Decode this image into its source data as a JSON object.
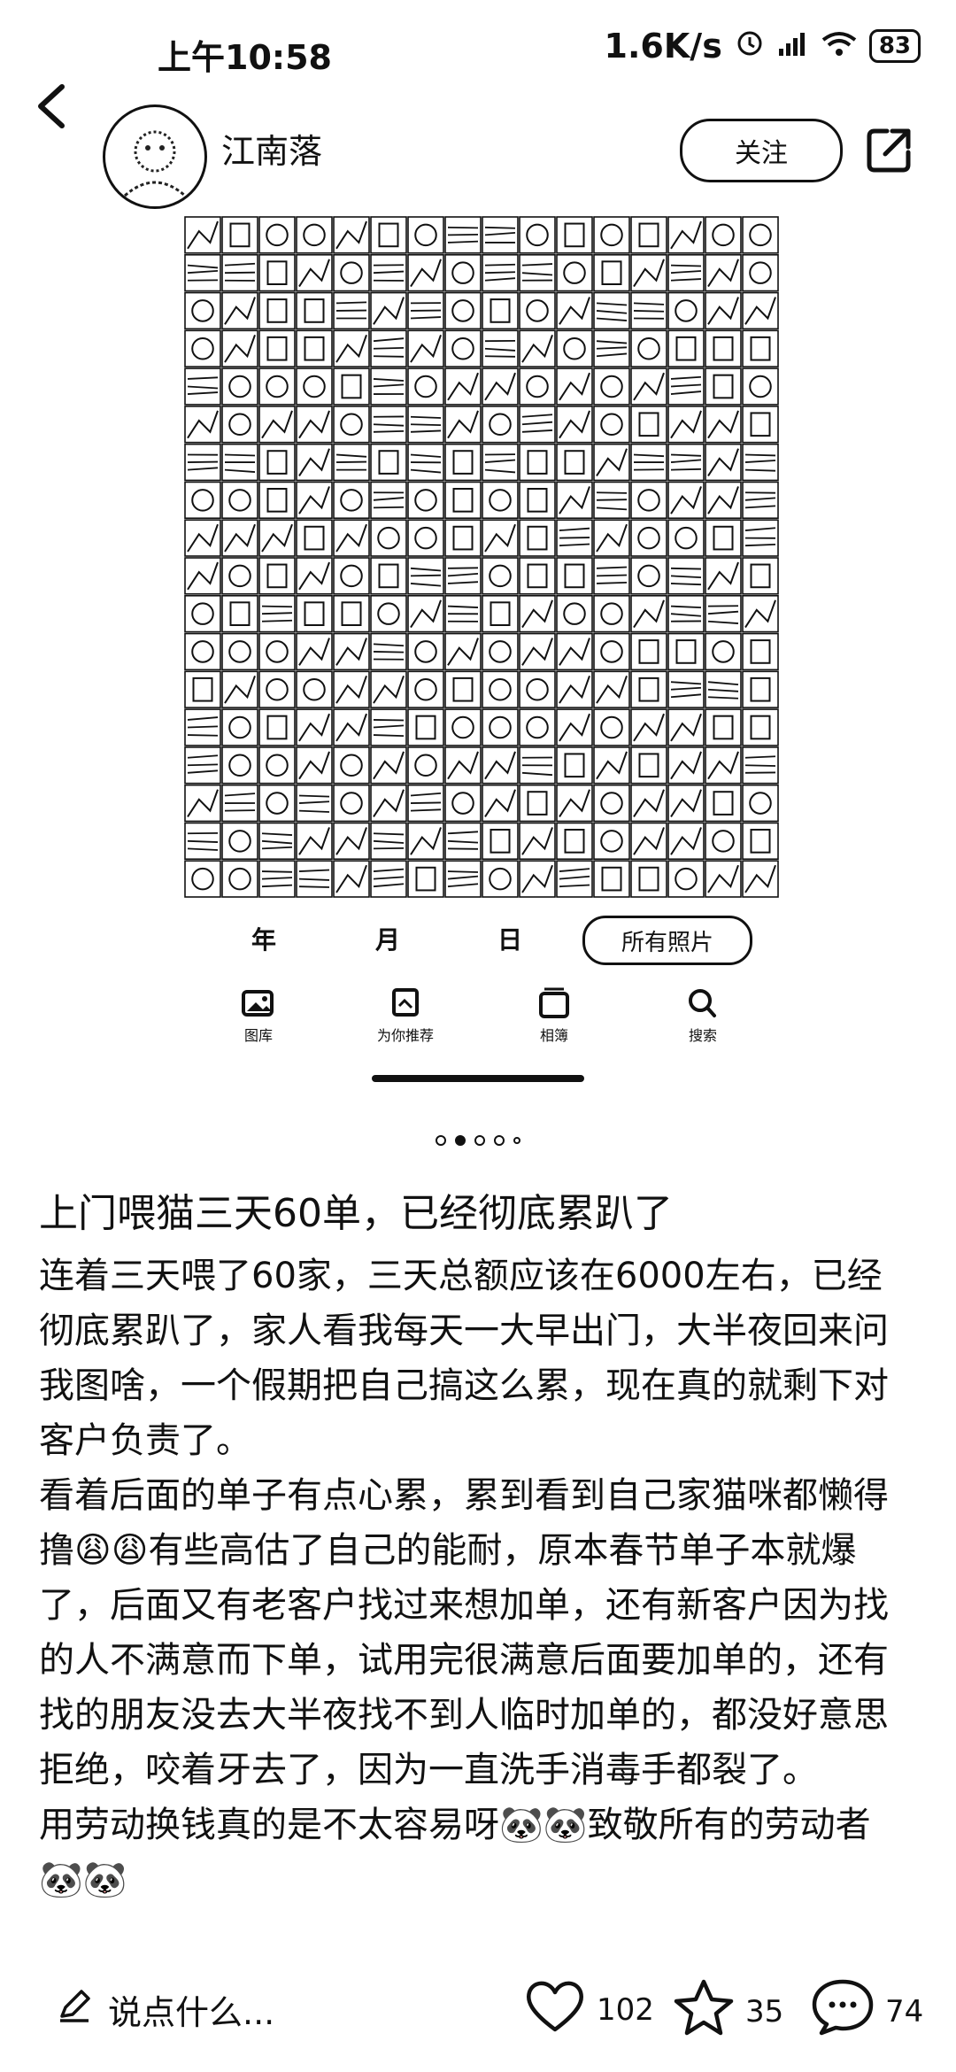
{
  "status_bar": {
    "time": "上午10:58",
    "net_speed": "1.6K/s",
    "battery": "83"
  },
  "header": {
    "username": "江南落",
    "follow_label": "关注"
  },
  "photo_preview": {
    "date_labels": [
      "年",
      "月",
      "日"
    ],
    "view_button": "所有照片",
    "tabs": [
      "图库",
      "为你推荐",
      "相簿",
      "搜索"
    ]
  },
  "carousel": {
    "count": 5,
    "active_index": 1
  },
  "post": {
    "title": "上门喂猫三天60单，已经彻底累趴了",
    "paragraphs": [
      "连着三天喂了60家，三天总额应该在6000左右，已经彻底累趴了，家人看我每天一大早出门，大半夜回来问我图啥，一个假期把自己搞这么累，现在真的就剩下对客户负责了。",
      "看着后面的单子有点心累，累到看到自己家猫咪都懒得撸😩😩有些高估了自己的能耐，原本春节单子本就爆了，后面又有老客户找过来想加单，还有新客户因为找的人不满意而下单，试用完很满意后面要加单的，还有找的朋友没去大半夜找不到人临时加单的，都没好意思拒绝，咬着牙去了，因为一直洗手消毒手都裂了。",
      "用劳动换钱真的是不太容易呀🐼🐼致敬所有的劳动者🐼🐼"
    ]
  },
  "bottom_bar": {
    "comment_placeholder": "说点什么...",
    "likes": "102",
    "favorites": "35",
    "comments": "74"
  }
}
